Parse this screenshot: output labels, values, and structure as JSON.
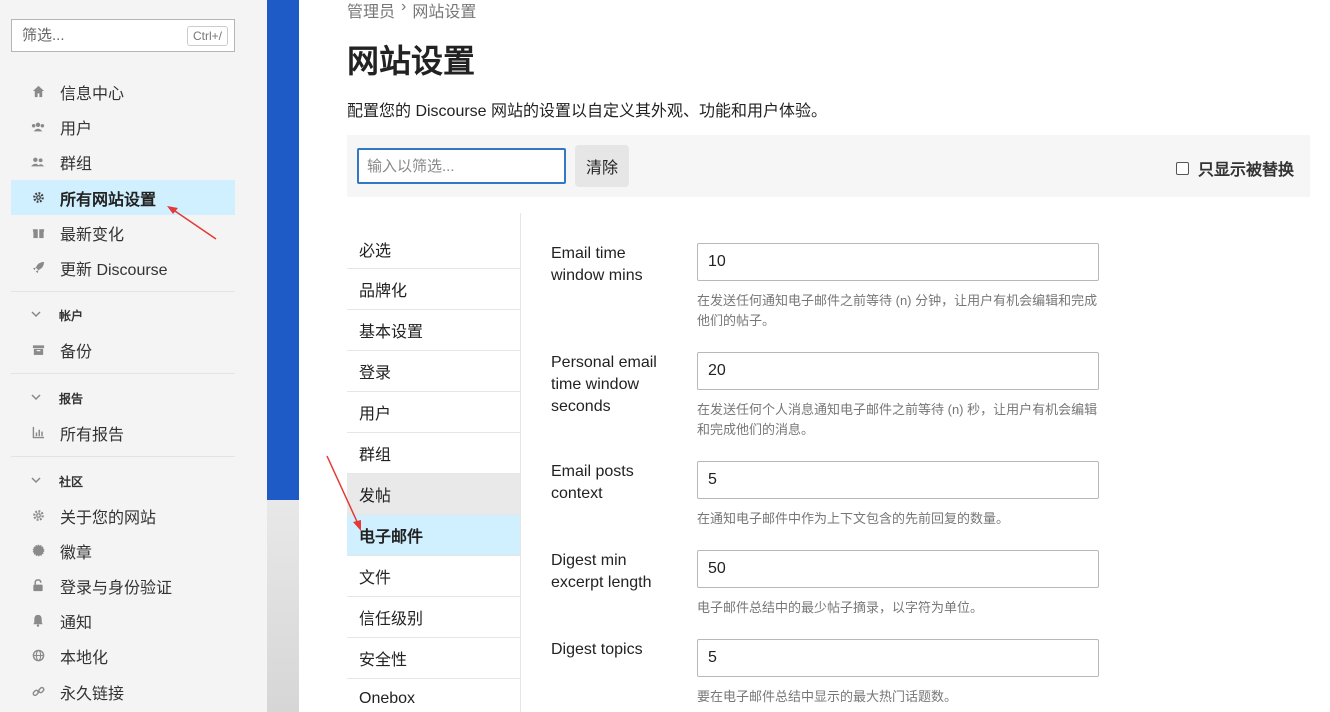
{
  "sidebar": {
    "filter_placeholder": "筛选...",
    "filter_shortcut": "Ctrl+/",
    "items_top": [
      {
        "label": "信息中心",
        "icon": "home-icon"
      },
      {
        "label": "用户",
        "icon": "users-icon"
      },
      {
        "label": "群组",
        "icon": "groups-icon"
      },
      {
        "label": "所有网站设置",
        "icon": "gear-icon",
        "active": true
      },
      {
        "label": "最新变化",
        "icon": "gift-icon"
      },
      {
        "label": "更新 Discourse",
        "icon": "rocket-icon"
      }
    ],
    "section_account": {
      "title": "帐户",
      "items": [
        {
          "label": "备份",
          "icon": "archive-icon"
        }
      ]
    },
    "section_reports": {
      "title": "报告",
      "items": [
        {
          "label": "所有报告",
          "icon": "chart-icon"
        }
      ]
    },
    "section_community": {
      "title": "社区",
      "items": [
        {
          "label": "关于您的网站",
          "icon": "gear-icon"
        },
        {
          "label": "徽章",
          "icon": "badge-icon"
        },
        {
          "label": "登录与身份验证",
          "icon": "lock-icon"
        },
        {
          "label": "通知",
          "icon": "bell-icon"
        },
        {
          "label": "本地化",
          "icon": "globe-icon"
        },
        {
          "label": "永久链接",
          "icon": "link-icon"
        }
      ]
    }
  },
  "breadcrumb": {
    "first": "管理员",
    "separator": "›",
    "second": "网站设置"
  },
  "page": {
    "title": "网站设置",
    "description": "配置您的 Discourse 网站的设置以自定义其外观、功能和用户体验。",
    "filter_placeholder": "输入以筛选...",
    "clear_label": "清除",
    "only_overridden_label": "只显示被替换"
  },
  "categories": [
    {
      "label": "必选"
    },
    {
      "label": "品牌化"
    },
    {
      "label": "基本设置"
    },
    {
      "label": "登录"
    },
    {
      "label": "用户"
    },
    {
      "label": "群组"
    },
    {
      "label": "发帖",
      "state": "hover"
    },
    {
      "label": "电子邮件",
      "state": "active"
    },
    {
      "label": "文件"
    },
    {
      "label": "信任级别"
    },
    {
      "label": "安全性"
    },
    {
      "label": "Onebox"
    }
  ],
  "settings": [
    {
      "label": "Email time window mins",
      "value": "10",
      "description": "在发送任何通知电子邮件之前等待 (n) 分钟，让用户有机会编辑和完成他们的帖子。"
    },
    {
      "label": "Personal email time window seconds",
      "value": "20",
      "description": "在发送任何个人消息通知电子邮件之前等待 (n) 秒，让用户有机会编辑和完成他们的消息。"
    },
    {
      "label": "Email posts context",
      "value": "5",
      "description": "在通知电子邮件中作为上下文包含的先前回复的数量。"
    },
    {
      "label": "Digest min excerpt length",
      "value": "50",
      "description": "电子邮件总结中的最少帖子摘录，以字符为单位。"
    },
    {
      "label": "Digest topics",
      "value": "5",
      "description": "要在电子邮件总结中显示的最大热门话题数。"
    }
  ],
  "colors": {
    "accent_blue": "#1f5bc6",
    "active_bg": "#d1f0ff",
    "annotation_red": "#e53935"
  }
}
